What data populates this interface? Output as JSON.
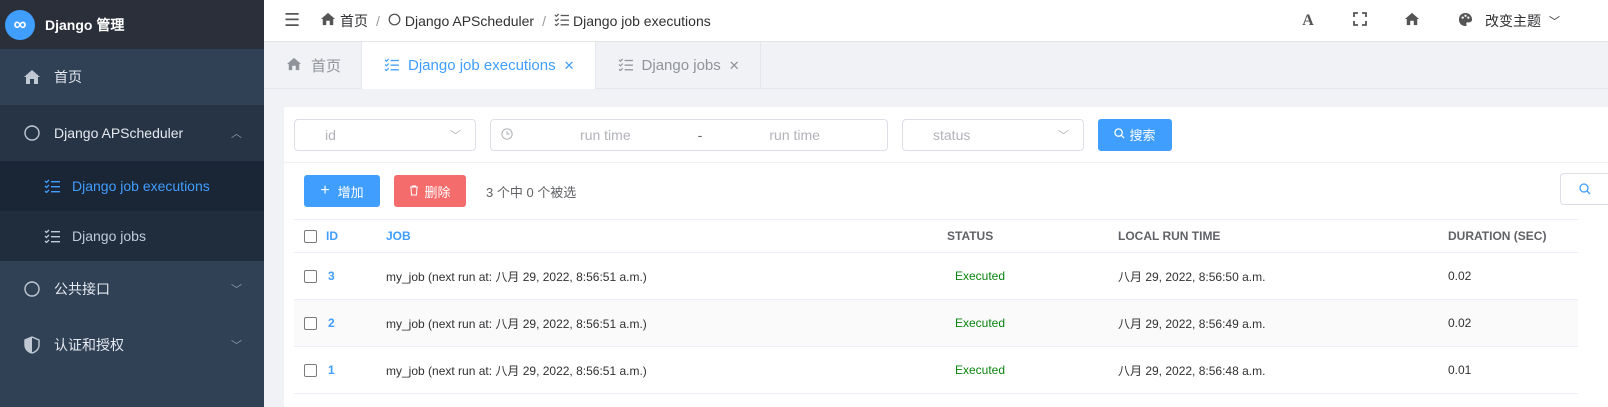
{
  "app": {
    "title": "Django 管理",
    "logo_glyph": "∞"
  },
  "sidebar": {
    "home": "首页",
    "groups": [
      {
        "label": "Django APScheduler",
        "expanded": true,
        "icon": "circle-icon",
        "items": [
          {
            "label": "Django job executions",
            "active": true,
            "icon": "list-check-icon"
          },
          {
            "label": "Django jobs",
            "active": false,
            "icon": "list-check-icon"
          }
        ]
      },
      {
        "label": "公共接口",
        "expanded": false,
        "icon": "circle-icon"
      },
      {
        "label": "认证和授权",
        "expanded": false,
        "icon": "shield-icon"
      }
    ]
  },
  "breadcrumb": {
    "home": "首页",
    "group": "Django APScheduler",
    "page": "Django job executions"
  },
  "topbar": {
    "theme_label": "改变主题"
  },
  "tabs": [
    {
      "label": "首页",
      "active": false,
      "closable": false
    },
    {
      "label": "Django job executions",
      "active": true,
      "closable": true
    },
    {
      "label": "Django jobs",
      "active": false,
      "closable": true
    }
  ],
  "filters": {
    "id_placeholder": "id",
    "run_time_start": "run time",
    "run_time_sep": "-",
    "run_time_end": "run time",
    "status_placeholder": "status",
    "search_label": "搜索"
  },
  "actions": {
    "add_label": "增加",
    "delete_label": "删除",
    "selection_info": "3 个中 0 个被选"
  },
  "table": {
    "columns": [
      "ID",
      "JOB",
      "STATUS",
      "LOCAL RUN TIME",
      "DURATION (SEC)"
    ],
    "rows": [
      {
        "id": "3",
        "job": "my_job (next run at: 八月 29, 2022, 8:56:51 a.m.)",
        "status": "Executed",
        "run_time": "八月 29, 2022, 8:56:50 a.m.",
        "duration": "0.02"
      },
      {
        "id": "2",
        "job": "my_job (next run at: 八月 29, 2022, 8:56:51 a.m.)",
        "status": "Executed",
        "run_time": "八月 29, 2022, 8:56:49 a.m.",
        "duration": "0.02"
      },
      {
        "id": "1",
        "job": "my_job (next run at: 八月 29, 2022, 8:56:51 a.m.)",
        "status": "Executed",
        "run_time": "八月 29, 2022, 8:56:48 a.m.",
        "duration": "0.01"
      }
    ]
  },
  "colors": {
    "accent": "#409eff",
    "danger": "#f56c6c",
    "sidebar_bg": "#304156",
    "status_ok": "#08840f"
  }
}
